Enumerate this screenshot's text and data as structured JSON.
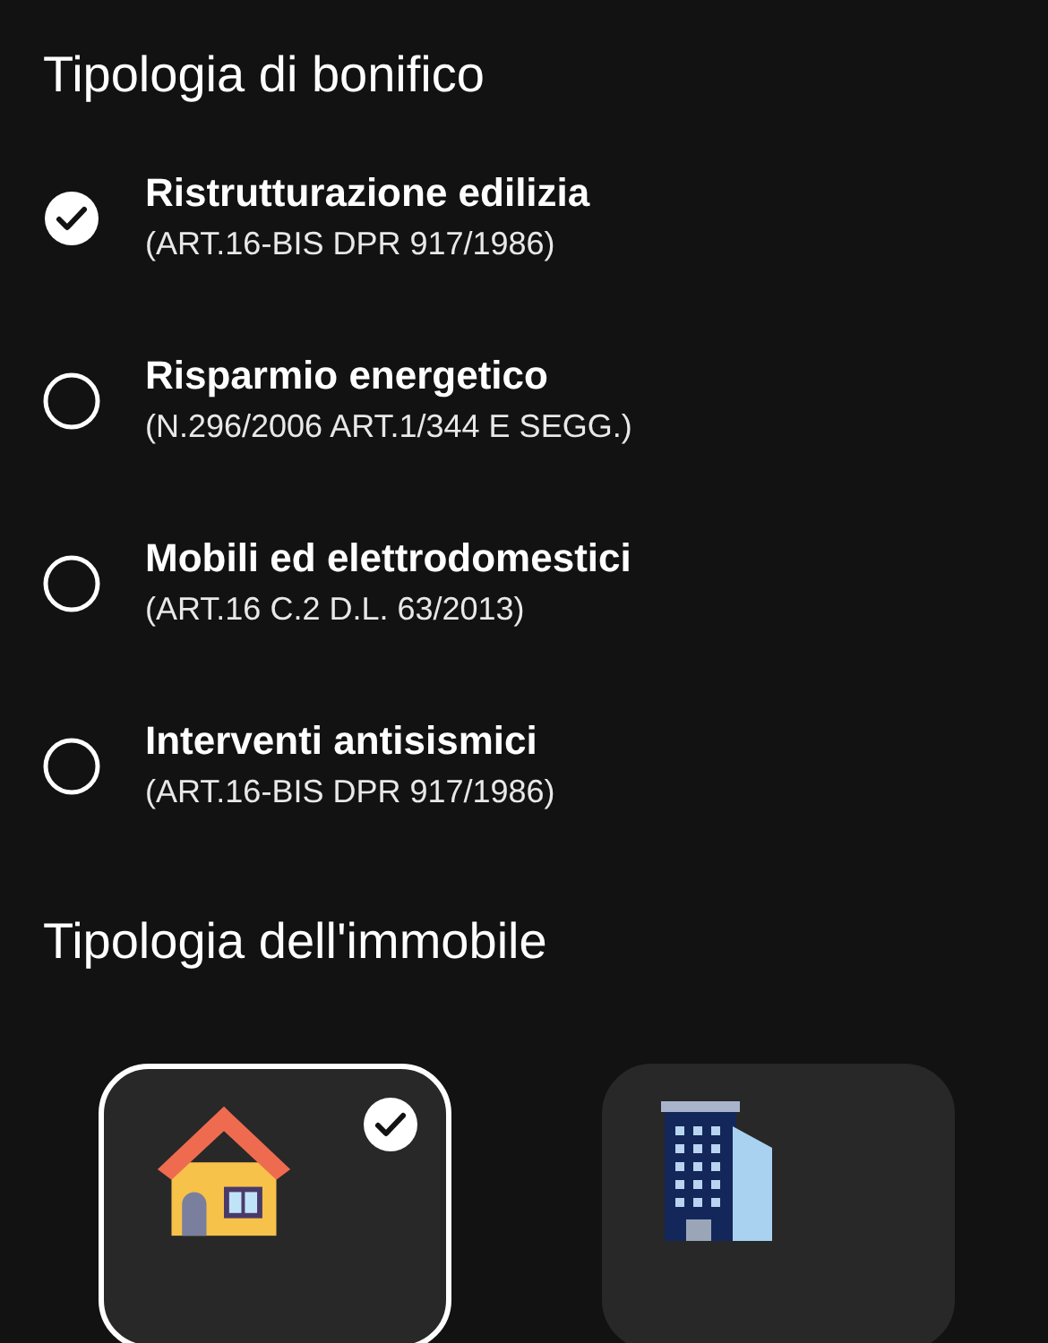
{
  "sections": [
    {
      "title": "Tipologia di bonifico"
    },
    {
      "title": "Tipologia dell'immobile"
    }
  ],
  "bonifico_options": [
    {
      "label": "Ristrutturazione edilizia",
      "sublabel": "(ART.16-BIS DPR 917/1986)",
      "selected": true
    },
    {
      "label": "Risparmio energetico",
      "sublabel": "(N.296/2006 ART.1/344 E SEGG.)",
      "selected": false
    },
    {
      "label": "Mobili ed elettrodomestici",
      "sublabel": "(ART.16 C.2 D.L. 63/2013)",
      "selected": false
    },
    {
      "label": "Interventi antisismici",
      "sublabel": "(ART.16-BIS DPR 917/1986)",
      "selected": false
    }
  ],
  "property_cards": [
    {
      "kind": "house",
      "selected": true
    },
    {
      "kind": "building",
      "selected": false
    }
  ]
}
